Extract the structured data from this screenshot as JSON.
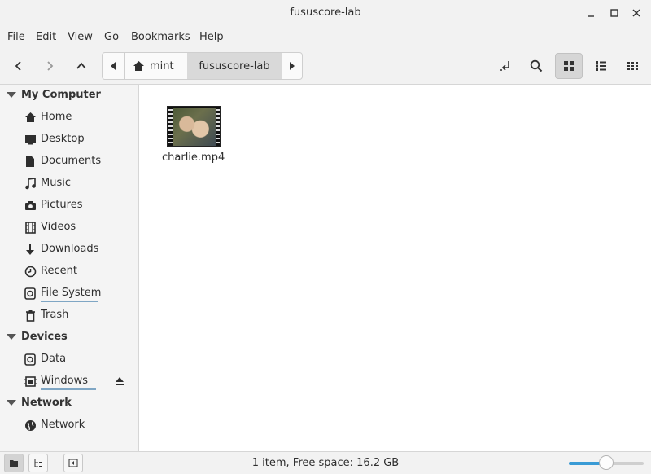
{
  "window": {
    "title": "fususcore-lab"
  },
  "menu": [
    "File",
    "Edit",
    "View",
    "Go",
    "Bookmarks",
    "Help"
  ],
  "pathbar": {
    "home_crumb": "mint",
    "current_crumb": "fususcore-lab"
  },
  "sidebar": {
    "sections": [
      {
        "title": "My Computer",
        "items": [
          "Home",
          "Desktop",
          "Documents",
          "Music",
          "Pictures",
          "Videos",
          "Downloads",
          "Recent",
          "File System",
          "Trash"
        ]
      },
      {
        "title": "Devices",
        "items": [
          "Data",
          "Windows"
        ]
      },
      {
        "title": "Network",
        "items": [
          "Network"
        ]
      }
    ],
    "usage": {
      "file_system": 0.95,
      "windows": 0.9
    }
  },
  "files": [
    {
      "name": "charlie.mp4",
      "icon": "video-thumbnail"
    }
  ],
  "status": {
    "text": "1 item, Free space: 16.2 GB"
  },
  "zoom": {
    "level": 0.5
  },
  "colors": {
    "accent": "#3a9bd5",
    "usage_bar": "#7fa6c4"
  }
}
